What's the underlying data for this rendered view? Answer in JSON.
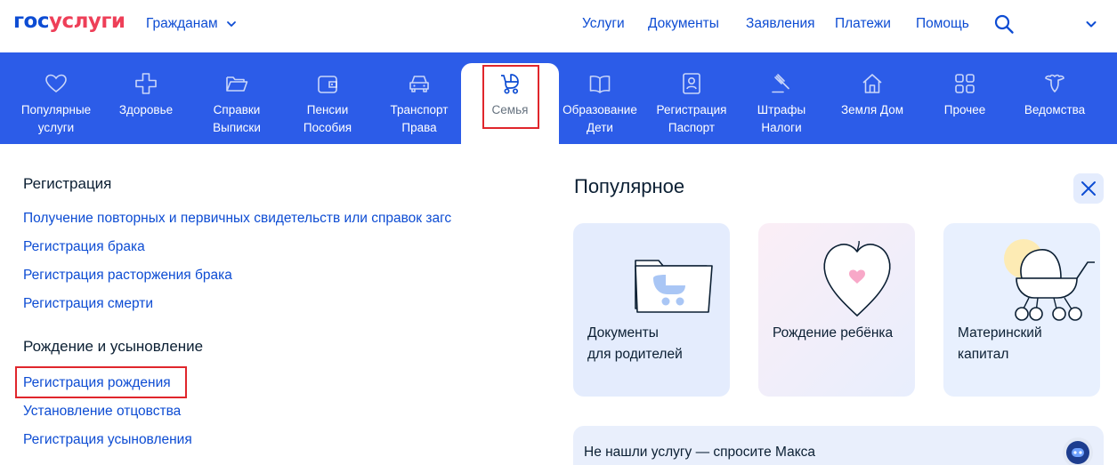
{
  "header": {
    "logo_part1": "гос",
    "logo_part2": "услуги",
    "audience": "Гражданам",
    "nav": [
      "Услуги",
      "Документы",
      "Заявления",
      "Платежи",
      "Помощь"
    ]
  },
  "categories": [
    {
      "label": "Популярные\nуслуги",
      "icon": "heart-icon"
    },
    {
      "label": "Здоровье",
      "icon": "medical-cross-icon"
    },
    {
      "label": "Справки\nВыписки",
      "icon": "folder-icon"
    },
    {
      "label": "Пенсии\nПособия",
      "icon": "wallet-icon"
    },
    {
      "label": "Транспорт\nПрава",
      "icon": "car-icon"
    },
    {
      "label": "Семья",
      "icon": "stroller-icon",
      "active": true
    },
    {
      "label": "Образование\nДети",
      "icon": "book-icon"
    },
    {
      "label": "Регистрация\nПаспорт",
      "icon": "passport-icon"
    },
    {
      "label": "Штрафы\nНалоги",
      "icon": "gavel-icon"
    },
    {
      "label": "Земля Дом",
      "icon": "house-icon"
    },
    {
      "label": "Прочее",
      "icon": "grid-icon"
    },
    {
      "label": "Ведомства",
      "icon": "emblem-icon"
    }
  ],
  "sections": [
    {
      "title": "Регистрация",
      "links": [
        "Получение повторных и первичных свидетельств или справок загс",
        "Регистрация брака",
        "Регистрация расторжения брака",
        "Регистрация смерти"
      ]
    },
    {
      "title": "Рождение и усыновление",
      "links": [
        "Регистрация рождения",
        "Установление отцовства",
        "Регистрация усыновления"
      ]
    }
  ],
  "popular": {
    "title": "Популярное",
    "cards": [
      {
        "text": "Документы\nдля родителей",
        "bg": "#e4ecfd"
      },
      {
        "text": "Рождение ребёнка",
        "bg": "#f3efff"
      },
      {
        "text": "Материнский\nкапитал",
        "bg": "#e8f0fe"
      }
    ]
  },
  "ask": {
    "text": "Не нашли услугу — спросите Макса"
  },
  "colors": {
    "brand_blue": "#0d4cd3",
    "brand_red": "#ee3f58",
    "category_bar": "#2c5ce8",
    "highlight_box": "#e0262c"
  }
}
